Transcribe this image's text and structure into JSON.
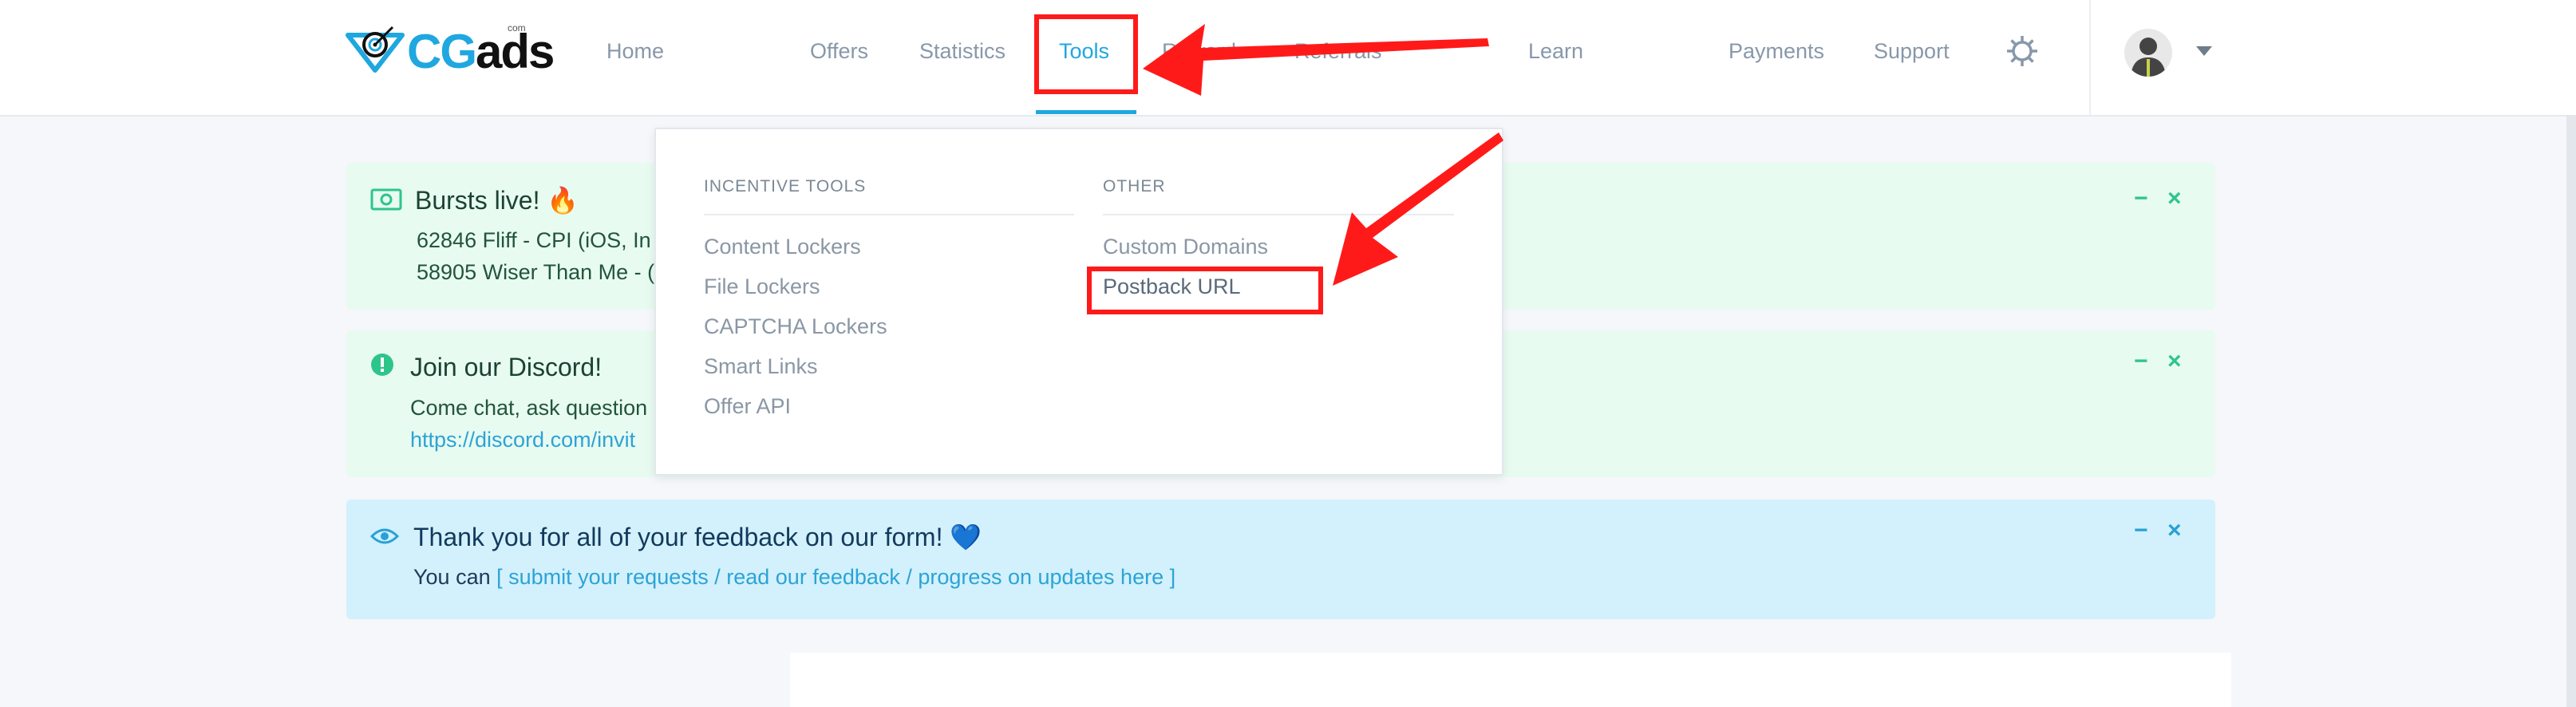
{
  "brand": {
    "logo_part1": "CG",
    "logo_part2": "ads",
    "logo_small": "com"
  },
  "nav": {
    "home": "Home",
    "offers": "Offers",
    "statistics": "Statistics",
    "tools": "Tools",
    "rewards_partial": "Rewards",
    "referrals_partial": "Referrals",
    "learn": "Learn",
    "payments": "Payments",
    "support": "Support"
  },
  "alerts": {
    "bursts": {
      "title": "Bursts live! 🔥",
      "line1": "62846 Fliff - CPI (iOS, In",
      "line2": "58905 Wiser Than Me - ("
    },
    "discord": {
      "title": "Join our Discord!",
      "line1": "Come chat, ask question",
      "line2": "https://discord.com/invit"
    },
    "feedback": {
      "title": "Thank you for all of your feedback on our form! 💙",
      "prefix": "You can",
      "link": "[ submit your requests / read our feedback /  progress on updates here ]"
    },
    "minimize": "−",
    "close": "×"
  },
  "dropdown": {
    "incentive_heading": "INCENTIVE TOOLS",
    "incentive_items": [
      "Content Lockers",
      "File Lockers",
      "CAPTCHA Lockers",
      "Smart Links",
      "Offer API"
    ],
    "other_heading": "OTHER",
    "other_items": [
      "Custom Domains",
      "Postback URL"
    ]
  },
  "colors": {
    "accent": "#1fa7e0",
    "annotation": "#ff1a1a",
    "alert_green": "#e8fbf1",
    "alert_blue": "#d2f1fc"
  },
  "icons": {
    "alert1": "cash-icon",
    "alert2": "exclamation-circle-icon",
    "alert3": "eye-icon",
    "settings": "gear-icon",
    "profile": "avatar-icon"
  }
}
